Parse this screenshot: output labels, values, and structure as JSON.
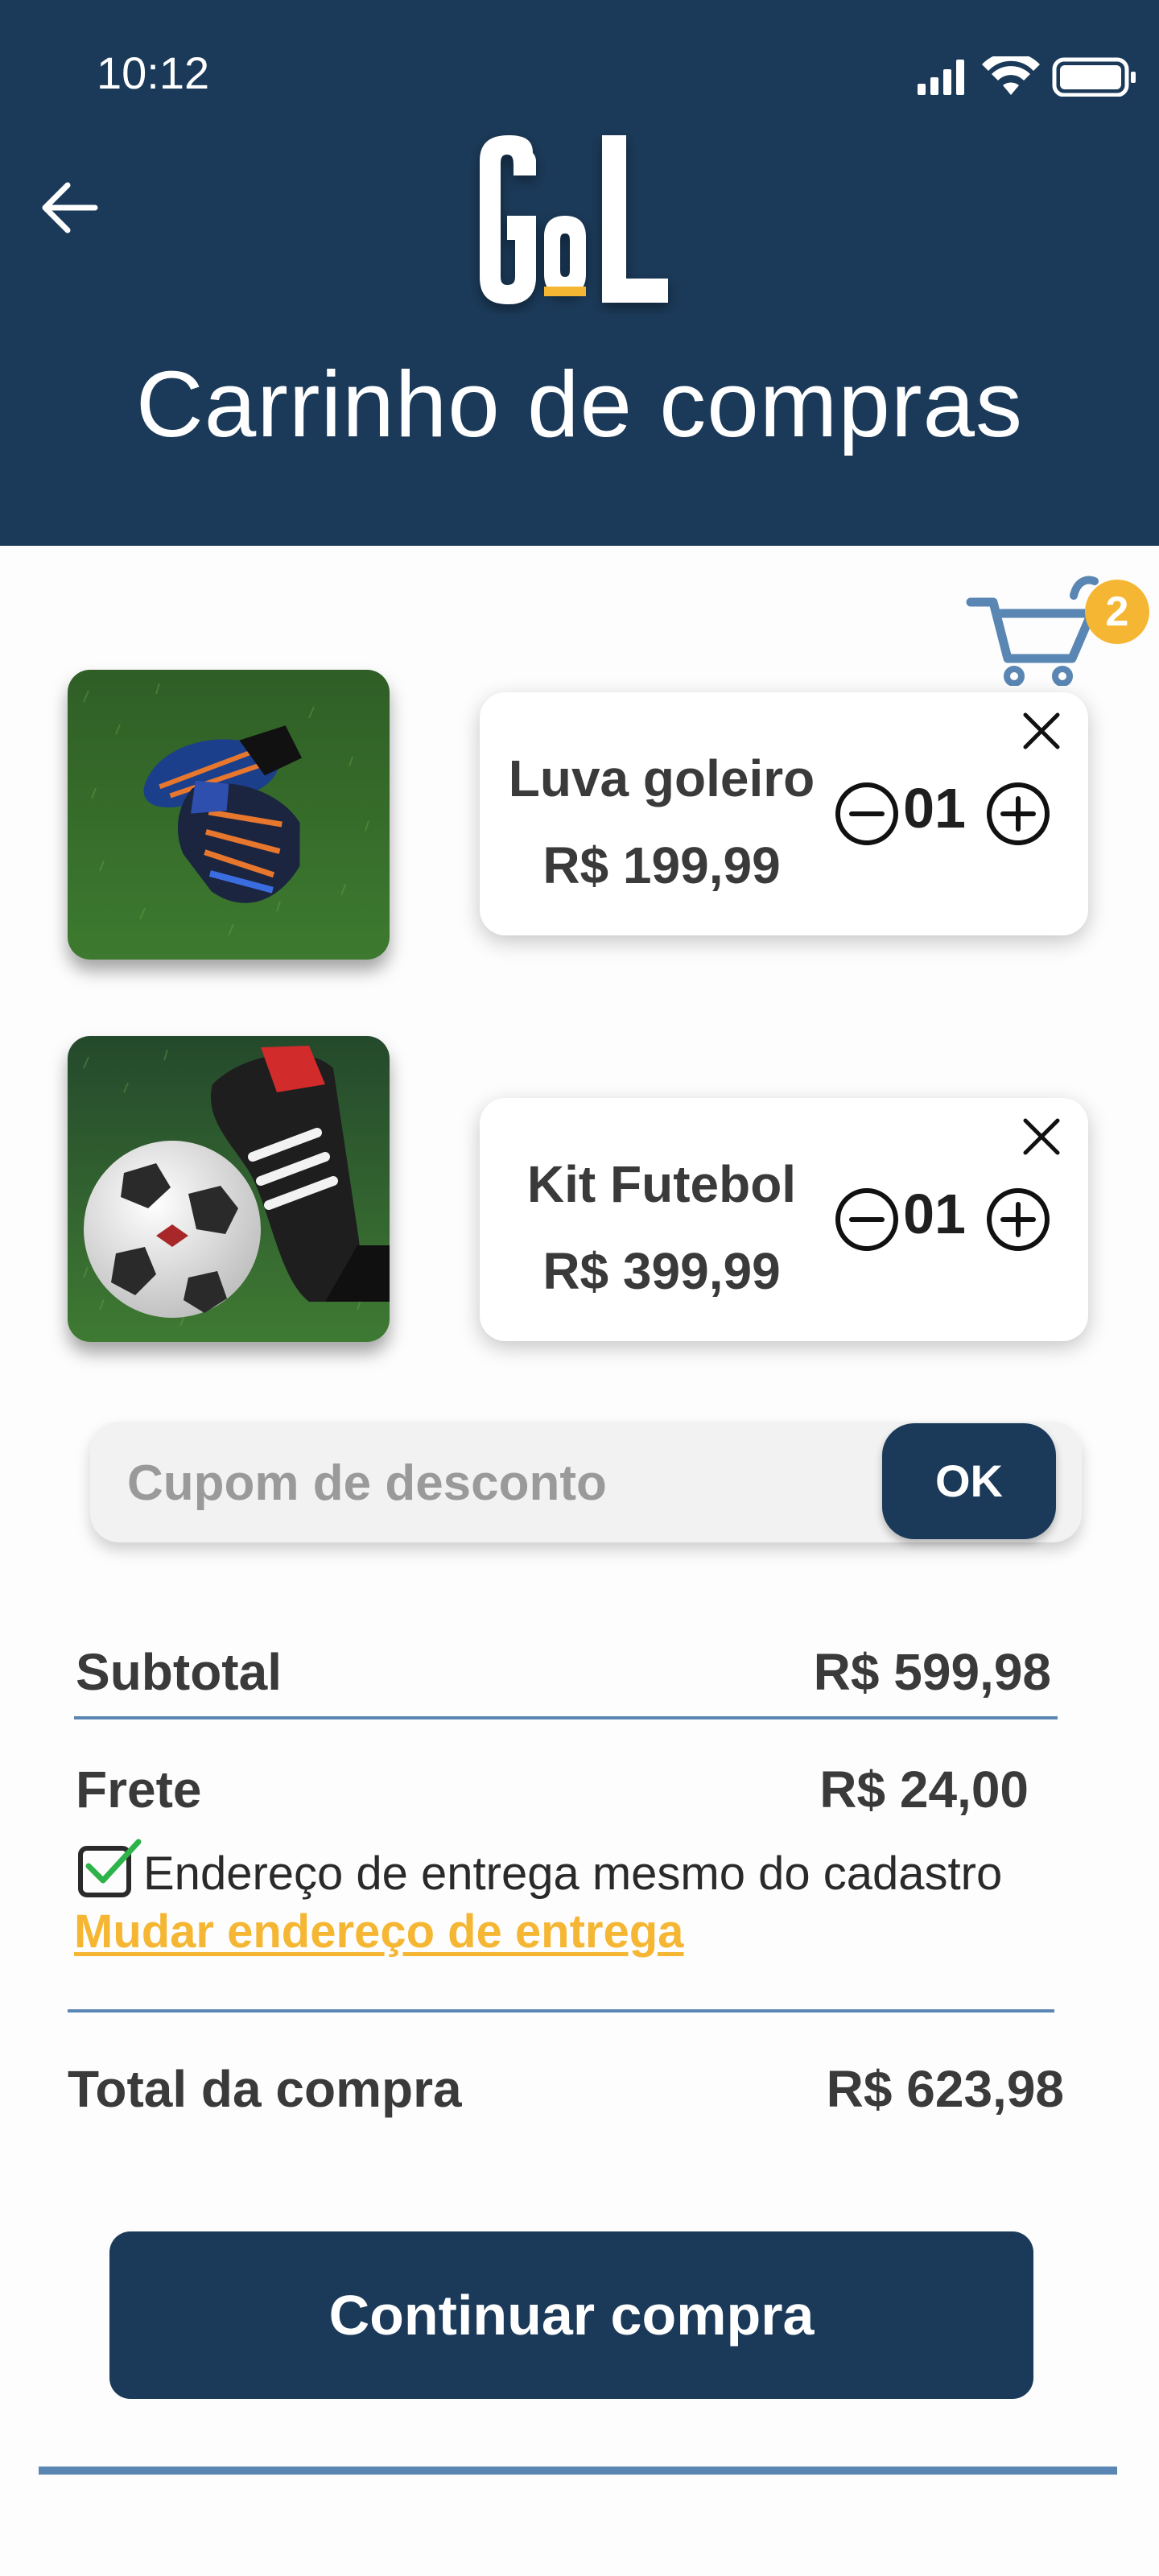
{
  "status_bar": {
    "time": "10:12"
  },
  "header": {
    "title": "Carrinho de compras",
    "brand": "GoL"
  },
  "cart": {
    "count": "2"
  },
  "items": [
    {
      "name": "Luva goleiro",
      "price": "R$ 199,99",
      "quantity": "01",
      "image": "goalkeeper-gloves-photo"
    },
    {
      "name": "Kit Futebol",
      "price": "R$ 399,99",
      "quantity": "01",
      "image": "soccer-ball-and-boots-photo"
    }
  ],
  "coupon": {
    "placeholder": "Cupom de desconto",
    "ok_label": "OK"
  },
  "summary": {
    "subtotal_label": "Subtotal",
    "subtotal_value": "R$ 599,98",
    "shipping_label": "Frete",
    "shipping_value": "R$ 24,00",
    "same_address_label": "Endereço de entrega mesmo do cadastro",
    "same_address_checked": true,
    "change_address_label": "Mudar endereço de entrega",
    "total_label": "Total da compra",
    "total_value": "R$ 623,98"
  },
  "continue_label": "Continuar compra",
  "colors": {
    "primary": "#1b3a59",
    "accent": "#f5b733",
    "divider": "#5a86b3",
    "check": "#2db34a"
  }
}
